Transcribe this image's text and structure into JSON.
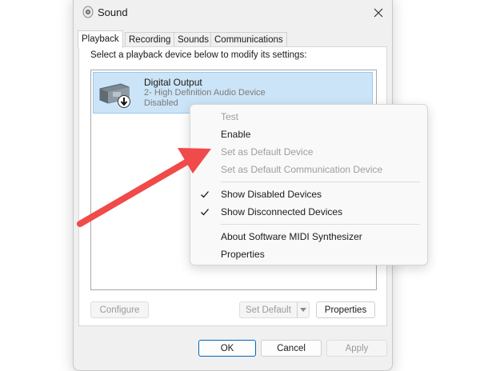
{
  "window": {
    "title": "Sound",
    "icon": "speaker-icon",
    "close_icon": "close-icon"
  },
  "tabs": [
    {
      "label": "Playback",
      "active": true
    },
    {
      "label": "Recording",
      "active": false
    },
    {
      "label": "Sounds",
      "active": false
    },
    {
      "label": "Communications",
      "active": false
    }
  ],
  "playback": {
    "instruction": "Select a playback device below to modify its settings:",
    "devices": [
      {
        "name": "Digital Output",
        "description": "2- High Definition Audio Device",
        "status": "Disabled",
        "icon": "speaker-device-icon",
        "badge": "disabled-down-arrow-icon",
        "selected": true
      }
    ]
  },
  "panel_buttons": {
    "configure": "Configure",
    "set_default": "Set Default",
    "properties": "Properties"
  },
  "dialog_buttons": {
    "ok": "OK",
    "cancel": "Cancel",
    "apply": "Apply"
  },
  "context_menu": {
    "items": [
      {
        "label": "Test",
        "enabled": false
      },
      {
        "label": "Enable",
        "enabled": true
      },
      {
        "label": "Set as Default Device",
        "enabled": false
      },
      {
        "label": "Set as Default Communication Device",
        "enabled": false
      },
      {
        "label": "Show Disabled Devices",
        "enabled": true,
        "checked": true
      },
      {
        "label": "Show Disconnected Devices",
        "enabled": true,
        "checked": true
      },
      {
        "label": "About Software MIDI Synthesizer",
        "enabled": true
      },
      {
        "label": "Properties",
        "enabled": true
      }
    ]
  },
  "annotation": {
    "type": "arrow",
    "color": "#f04a4a"
  },
  "colors": {
    "selection": "#cce4f7",
    "accent": "#0067c0",
    "disabled_text": "#9d9d9d"
  }
}
